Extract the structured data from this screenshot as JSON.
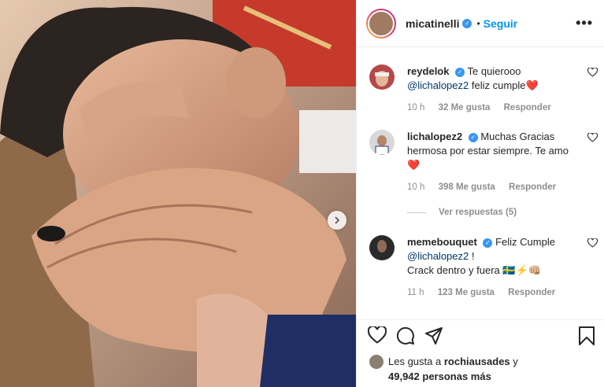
{
  "post": {
    "username": "micatinelli",
    "dot": "•",
    "follow_label": "Seguir",
    "more_label": "•••"
  },
  "comments": [
    {
      "user": "reydelok",
      "text_before": "Te quierooo",
      "mention": "@lichalopez2",
      "text_after": " feliz cumple",
      "emoji": "❤️",
      "time": "10 h",
      "likes": "32 Me gusta",
      "reply_label": "Responder"
    },
    {
      "user": "lichalopez2",
      "text": "Muchas Gracias hermosa por estar siempre. Te amo",
      "emoji": "❤️",
      "time": "10 h",
      "likes": "398 Me gusta",
      "reply_label": "Responder"
    },
    {
      "user": "memebouquet",
      "text_before": "Feliz Cumple",
      "mention": "@lichalopez2",
      "text_after": " !",
      "line3": "Crack dentro y fuera",
      "emoji": "🇸🇪⚡👊🏼",
      "time": "11 h",
      "likes": "123 Me gusta",
      "reply_label": "Responder"
    }
  ],
  "view_replies_label": "Ver respuestas (5)",
  "likes_summary": {
    "prefix": "Les gusta a",
    "user": "rochiausades",
    "middle": "y",
    "count": "49,942 personas más"
  },
  "icons": [
    "heart-icon",
    "comment-icon",
    "share-icon",
    "bookmark-icon",
    "chevron-right-icon",
    "more-options-icon",
    "verified-badge-icon"
  ],
  "colors": {
    "link": "#0095f6",
    "mention": "#00376b",
    "verified": "#3897f0",
    "meta": "#8e8e8e"
  }
}
